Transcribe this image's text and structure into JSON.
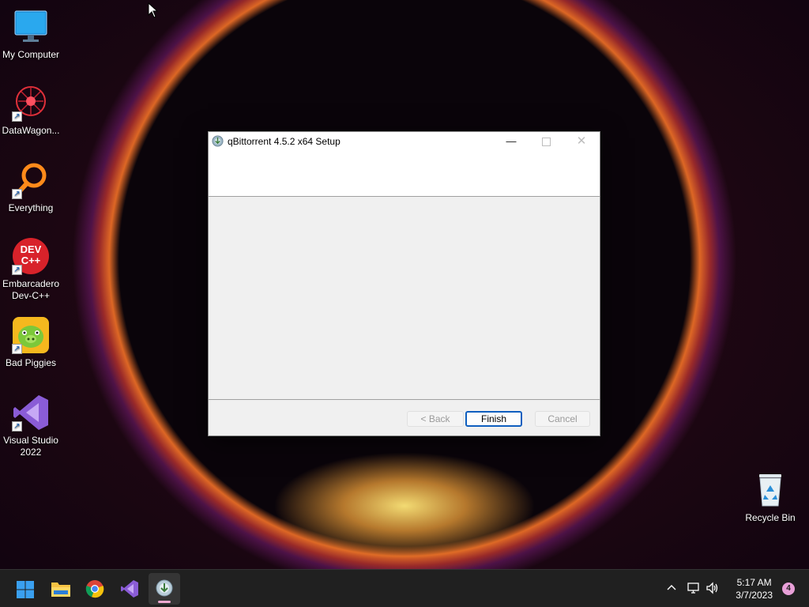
{
  "desktop": {
    "icons": [
      {
        "label": "My Computer",
        "icon": "monitor-icon"
      },
      {
        "label": "DataWagon...",
        "icon": "datawagon-icon"
      },
      {
        "label": "Everything",
        "icon": "search-magnifier-icon"
      },
      {
        "label": "Embarcadero Dev-C++",
        "icon": "devcpp-icon",
        "badge": "DEV C++"
      },
      {
        "label": "Bad Piggies",
        "icon": "bad-piggies-icon"
      },
      {
        "label": "Visual Studio 2022",
        "icon": "visual-studio-icon"
      },
      {
        "label": "Recycle Bin",
        "icon": "recycle-bin-icon"
      }
    ]
  },
  "window": {
    "title": "qBittorrent 4.5.2 x64 Setup",
    "buttons": {
      "back": "< Back",
      "finish": "Finish",
      "cancel": "Cancel"
    }
  },
  "taskbar": {
    "apps": [
      "start-icon",
      "file-explorer-icon",
      "chrome-icon",
      "visual-studio-icon",
      "qbittorrent-setup-icon"
    ],
    "clock": {
      "time": "5:17 AM",
      "date": "3/7/2023"
    },
    "notifications": "4"
  },
  "colors": {
    "accent": "#0f5fbf",
    "taskbar": "#202020"
  }
}
